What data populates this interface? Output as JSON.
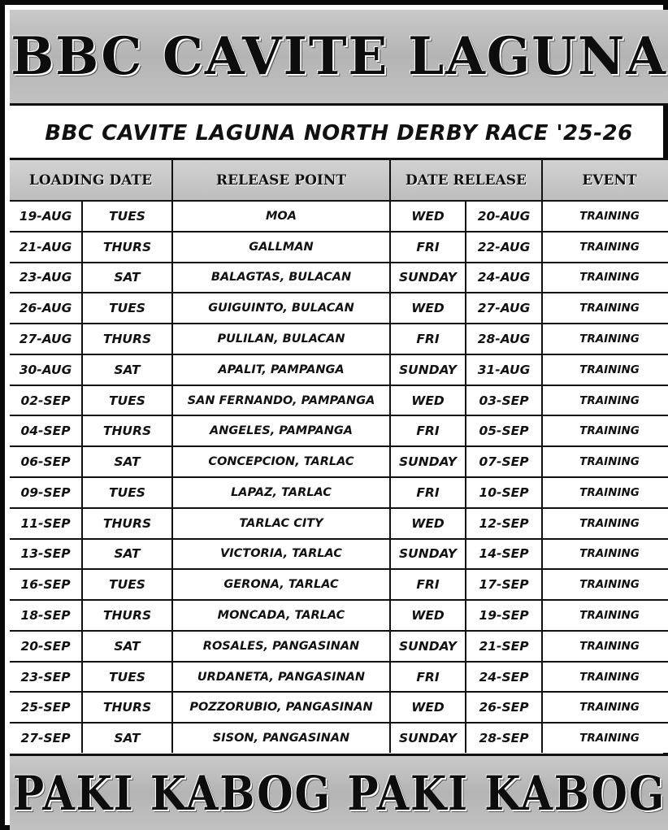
{
  "title": "BBC CAVITE LAGUNA",
  "subtitle": "BBC CAVITE LAGUNA  NORTH DERBY RACE '25-26",
  "headers": {
    "loading_date": "LOADING  DATE",
    "release_point": "RELEASE  POINT",
    "date_release": "DATE  RELEASE",
    "event": "EVENT"
  },
  "rows": [
    {
      "load_date": "19-AUG",
      "load_day": "TUES",
      "release_point": "MOA",
      "release_day": "WED",
      "release_date": "20-AUG",
      "event": "TRAINING"
    },
    {
      "load_date": "21-AUG",
      "load_day": "THURS",
      "release_point": "GALLMAN",
      "release_day": "FRI",
      "release_date": "22-AUG",
      "event": "TRAINING"
    },
    {
      "load_date": "23-AUG",
      "load_day": "SAT",
      "release_point": "BALAGTAS, BULACAN",
      "release_day": "SUNDAY",
      "release_date": "24-AUG",
      "event": "TRAINING"
    },
    {
      "load_date": "26-AUG",
      "load_day": "TUES",
      "release_point": "GUIGUINTO, BULACAN",
      "release_day": "WED",
      "release_date": "27-AUG",
      "event": "TRAINING"
    },
    {
      "load_date": "27-AUG",
      "load_day": "THURS",
      "release_point": "PULILAN, BULACAN",
      "release_day": "FRI",
      "release_date": "28-AUG",
      "event": "TRAINING"
    },
    {
      "load_date": "30-AUG",
      "load_day": "SAT",
      "release_point": "APALIT, PAMPANGA",
      "release_day": "SUNDAY",
      "release_date": "31-AUG",
      "event": "TRAINING"
    },
    {
      "load_date": "02-SEP",
      "load_day": "TUES",
      "release_point": "SAN FERNANDO, PAMPANGA",
      "release_day": "WED",
      "release_date": "03-SEP",
      "event": "TRAINING"
    },
    {
      "load_date": "04-SEP",
      "load_day": "THURS",
      "release_point": "ANGELES, PAMPANGA",
      "release_day": "FRI",
      "release_date": "05-SEP",
      "event": "TRAINING"
    },
    {
      "load_date": "06-SEP",
      "load_day": "SAT",
      "release_point": "CONCEPCION, TARLAC",
      "release_day": "SUNDAY",
      "release_date": "07-SEP",
      "event": "TRAINING"
    },
    {
      "load_date": "09-SEP",
      "load_day": "TUES",
      "release_point": "LAPAZ, TARLAC",
      "release_day": "FRI",
      "release_date": "10-SEP",
      "event": "TRAINING"
    },
    {
      "load_date": "11-SEP",
      "load_day": "THURS",
      "release_point": "TARLAC CITY",
      "release_day": "WED",
      "release_date": "12-SEP",
      "event": "TRAINING"
    },
    {
      "load_date": "13-SEP",
      "load_day": "SAT",
      "release_point": "VICTORIA, TARLAC",
      "release_day": "SUNDAY",
      "release_date": "14-SEP",
      "event": "TRAINING"
    },
    {
      "load_date": "16-SEP",
      "load_day": "TUES",
      "release_point": "GERONA, TARLAC",
      "release_day": "FRI",
      "release_date": "17-SEP",
      "event": "TRAINING"
    },
    {
      "load_date": "18-SEP",
      "load_day": "THURS",
      "release_point": "MONCADA, TARLAC",
      "release_day": "WED",
      "release_date": "19-SEP",
      "event": "TRAINING"
    },
    {
      "load_date": "20-SEP",
      "load_day": "SAT",
      "release_point": "ROSALES, PANGASINAN",
      "release_day": "SUNDAY",
      "release_date": "21-SEP",
      "event": "TRAINING"
    },
    {
      "load_date": "23-SEP",
      "load_day": "TUES",
      "release_point": "URDANETA, PANGASINAN",
      "release_day": "FRI",
      "release_date": "24-SEP",
      "event": "TRAINING"
    },
    {
      "load_date": "25-SEP",
      "load_day": "THURS",
      "release_point": "POZZORUBIO, PANGASINAN",
      "release_day": "WED",
      "release_date": "26-SEP",
      "event": "TRAINING"
    },
    {
      "load_date": "27-SEP",
      "load_day": "SAT",
      "release_point": "SISON, PANGASINAN",
      "release_day": "SUNDAY",
      "release_date": "28-SEP",
      "event": "TRAINING"
    }
  ],
  "footer": "PAKI KABOG PAKI KABOG",
  "colors": {
    "banner_bg": "#c2c2c2",
    "text": "#111111",
    "border": "#111111",
    "cell_bg": "#ffffff"
  }
}
